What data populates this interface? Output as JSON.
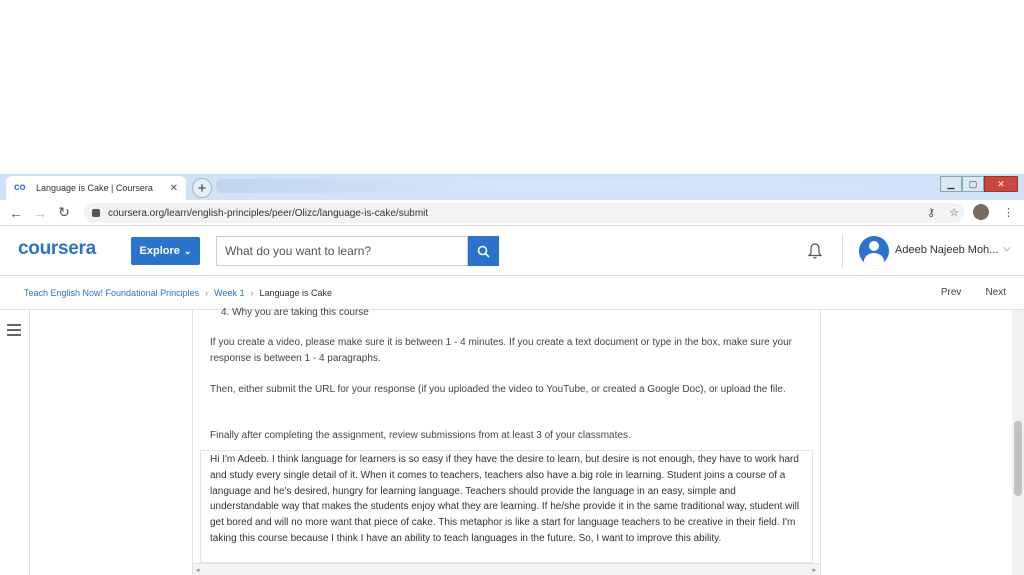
{
  "browser": {
    "tab_title": "Language is Cake | Coursera",
    "tab_favicon": "co",
    "url": "coursera.org/learn/english-principles/peer/Olizc/language-is-cake/submit"
  },
  "header": {
    "logo": "coursera",
    "explore_label": "Explore",
    "search_placeholder": "What do you want to learn?",
    "username": "Adeeb Najeeb Moh..."
  },
  "breadcrumb": {
    "items": [
      "Teach English Now! Foundational Principles",
      "Week 1"
    ],
    "current": "Language is Cake",
    "prev": "Prev",
    "next": "Next"
  },
  "instructions": {
    "list_item_4": "4.  Why you are taking this course",
    "para1": "If you create a video, please make sure it is between 1 - 4 minutes. If you create a text document or type in the box, make sure your response is between 1 - 4 paragraphs.",
    "para2": "Then, either submit the URL for your response (if you uploaded the video to YouTube, or created a Google Doc), or upload the file.",
    "para3": "Finally after completing the assignment, review submissions from at least 3 of your classmates."
  },
  "submission": {
    "text": "Hi I'm Adeeb. I think language for learners is so easy if they have the desire to learn, but desire is not enough, they have to work hard and study every single detail of it. When it comes to teachers, teachers also have a big role in learning. Student joins a course of a language and he's desired, hungry for learning language. Teachers should provide the language in an easy, simple and understandable way that makes the students enjoy what they are learning. If he/she provide it in the same traditional way, student will get bored and will no more want that piece of cake. This metaphor is like a start for language teachers to be creative in their field. I'm taking this course because I think I have an ability to teach languages in the future. So, I want to improve this ability."
  },
  "colors": {
    "accent": "#2a73cc"
  }
}
